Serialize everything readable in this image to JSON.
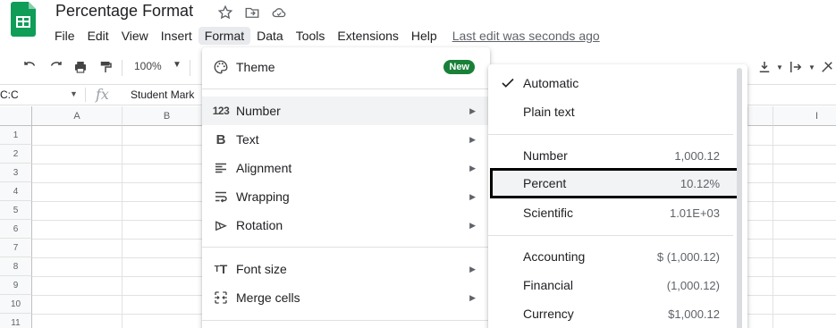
{
  "app": {
    "title": "Percentage Format",
    "title_icons": [
      "star-icon",
      "move-to-folder-icon",
      "cloud-status-icon"
    ],
    "logo": "google-sheets-logo",
    "brand_color": "#0f9d58"
  },
  "menubar": {
    "items": [
      "File",
      "Edit",
      "View",
      "Insert",
      "Format",
      "Data",
      "Tools",
      "Extensions",
      "Help"
    ],
    "active": "Format",
    "last_edit": "Last edit was seconds ago"
  },
  "toolbar": {
    "zoom": "100%"
  },
  "formula_bar": {
    "name_box": "C:C",
    "fx_label": "fx",
    "value": "Student Mark"
  },
  "grid": {
    "columns": [
      "A",
      "B",
      "I"
    ],
    "rows": [
      "1",
      "2",
      "3",
      "4",
      "5",
      "6",
      "7",
      "8",
      "9",
      "10",
      "11"
    ]
  },
  "format_menu": {
    "items": [
      {
        "label": "Theme",
        "icon": "palette-icon",
        "badge": "New"
      },
      {
        "label": "Number",
        "icon": "number-123-icon",
        "submenu": true,
        "highlighted": true
      },
      {
        "label": "Text",
        "icon": "bold-text-icon",
        "submenu": true
      },
      {
        "label": "Alignment",
        "icon": "align-icon",
        "submenu": true
      },
      {
        "label": "Wrapping",
        "icon": "wrap-icon",
        "submenu": true
      },
      {
        "label": "Rotation",
        "icon": "rotation-icon",
        "submenu": true
      },
      {
        "label": "Font size",
        "icon": "font-size-icon",
        "submenu": true
      },
      {
        "label": "Merge cells",
        "icon": "merge-icon",
        "submenu": true
      }
    ]
  },
  "number_submenu": {
    "items": [
      {
        "label": "Automatic",
        "value": "",
        "checked": true
      },
      {
        "label": "Plain text",
        "value": ""
      },
      {
        "label": "Number",
        "value": "1,000.12"
      },
      {
        "label": "Percent",
        "value": "10.12%",
        "emphasized": true
      },
      {
        "label": "Scientific",
        "value": "1.01E+03"
      },
      {
        "label": "Accounting",
        "value": "$ (1,000.12)"
      },
      {
        "label": "Financial",
        "value": "(1,000.12)"
      },
      {
        "label": "Currency",
        "value": "$1,000.12"
      }
    ]
  }
}
